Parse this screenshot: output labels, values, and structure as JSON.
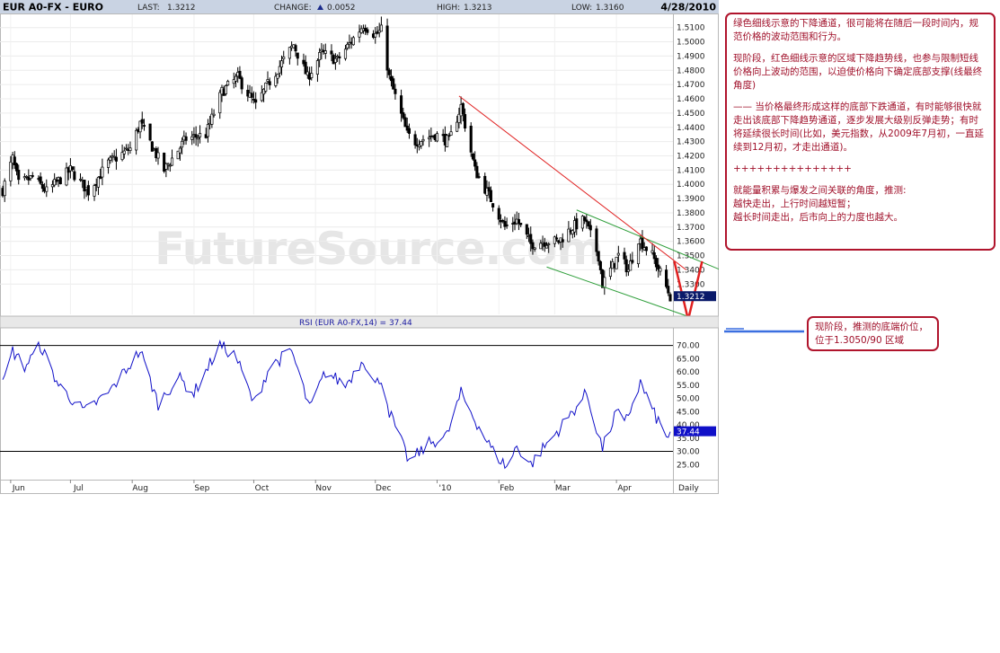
{
  "header": {
    "symbol": "EUR A0-FX - EURO",
    "last_label": "LAST:",
    "last_value": "1.3212",
    "change_label": "CHANGE:",
    "change_value": "0.0052",
    "high_label": "HIGH:",
    "high_value": "1.3213",
    "low_label": "LOW:",
    "low_value": "1.3160",
    "date": "4/28/2010"
  },
  "watermark": "FutureSource.com",
  "rsi_header": "RSI (EUR A0-FX,14) = 37.44",
  "timeframe": "Daily",
  "notes": {
    "main": [
      "绿色细线示意的下降通道，很可能将在随后一段时间内，规范价格的波动范围和行为。",
      "现阶段，红色细线示意的区域下降趋势线，也参与限制短线价格向上波动的范围，以迫使价格向下确定底部支撑(线最终角度)",
      "—— 当价格最终形成这样的底部下跌通道，有时能够很快就走出该底部下降趋势通道，逐步发展大级别反弹走势；有时将延续很长时间(比如，美元指数，从2009年7月初，一直延续到12月初，才走出通道)。",
      "+++++++++++++++",
      "就能量积累与爆发之间关联的角度，推测:\n越快走出，上行时间越短暂；\n越长时间走出，后市向上的力度也越大。"
    ],
    "side": "现阶段，推测的底端价位，位于1.3050/90 区域"
  },
  "chart_data": [
    {
      "type": "candlestick",
      "title": "EUR A0-FX - EURO",
      "x_tick_labels": [
        "Jun",
        "Jul",
        "Aug",
        "Sep",
        "Oct",
        "Nov",
        "Dec",
        "'10",
        "Feb",
        "Mar",
        "Apr"
      ],
      "y_tick_labels": [
        "1.5100",
        "1.5000",
        "1.4900",
        "1.4800",
        "1.4700",
        "1.4600",
        "1.4500",
        "1.4400",
        "1.4300",
        "1.4200",
        "1.4100",
        "1.4000",
        "1.3900",
        "1.3800",
        "1.3700",
        "1.3600",
        "1.3500",
        "1.3400",
        "1.3300"
      ],
      "ylim": [
        1.31,
        1.518
      ],
      "last_price_label": "1.3212",
      "grid": true,
      "close_waypoints": [
        {
          "x": "2009-05-28",
          "y": 1.396
        },
        {
          "x": "2009-06-02",
          "y": 1.418
        },
        {
          "x": "2009-06-05",
          "y": 1.4
        },
        {
          "x": "2009-06-12",
          "y": 1.405
        },
        {
          "x": "2009-06-19",
          "y": 1.395
        },
        {
          "x": "2009-07-01",
          "y": 1.41
        },
        {
          "x": "2009-07-10",
          "y": 1.395
        },
        {
          "x": "2009-07-20",
          "y": 1.415
        },
        {
          "x": "2009-07-31",
          "y": 1.425
        },
        {
          "x": "2009-08-05",
          "y": 1.443
        },
        {
          "x": "2009-08-17",
          "y": 1.41
        },
        {
          "x": "2009-08-28",
          "y": 1.432
        },
        {
          "x": "2009-09-07",
          "y": 1.435
        },
        {
          "x": "2009-09-15",
          "y": 1.465
        },
        {
          "x": "2009-09-23",
          "y": 1.475
        },
        {
          "x": "2009-10-02",
          "y": 1.455
        },
        {
          "x": "2009-10-08",
          "y": 1.47
        },
        {
          "x": "2009-10-21",
          "y": 1.498
        },
        {
          "x": "2009-10-28",
          "y": 1.475
        },
        {
          "x": "2009-11-04",
          "y": 1.492
        },
        {
          "x": "2009-11-12",
          "y": 1.487
        },
        {
          "x": "2009-11-25",
          "y": 1.512
        },
        {
          "x": "2009-12-01",
          "y": 1.505
        },
        {
          "x": "2009-12-04",
          "y": 1.508
        },
        {
          "x": "2009-12-08",
          "y": 1.475
        },
        {
          "x": "2009-12-17",
          "y": 1.435
        },
        {
          "x": "2009-12-21",
          "y": 1.43
        },
        {
          "x": "2009-12-31",
          "y": 1.435
        },
        {
          "x": "2010-01-07",
          "y": 1.43
        },
        {
          "x": "2010-01-13",
          "y": 1.455
        },
        {
          "x": "2010-01-20",
          "y": 1.41
        },
        {
          "x": "2010-01-29",
          "y": 1.387
        },
        {
          "x": "2010-02-04",
          "y": 1.37
        },
        {
          "x": "2010-02-10",
          "y": 1.375
        },
        {
          "x": "2010-02-17",
          "y": 1.358
        },
        {
          "x": "2010-02-23",
          "y": 1.36
        },
        {
          "x": "2010-03-03",
          "y": 1.36
        },
        {
          "x": "2010-03-10",
          "y": 1.37
        },
        {
          "x": "2010-03-16",
          "y": 1.375
        },
        {
          "x": "2010-03-23",
          "y": 1.35
        },
        {
          "x": "2010-03-25",
          "y": 1.33
        },
        {
          "x": "2010-04-02",
          "y": 1.35
        },
        {
          "x": "2010-04-07",
          "y": 1.34
        },
        {
          "x": "2010-04-12",
          "y": 1.362
        },
        {
          "x": "2010-04-19",
          "y": 1.35
        },
        {
          "x": "2010-04-23",
          "y": 1.338
        },
        {
          "x": "2010-04-28",
          "y": 1.3212
        }
      ],
      "annotations": {
        "green_channel_upper": [
          {
            "x": "2010-03-12",
            "y": 1.382
          },
          {
            "x": "2010-06-18",
            "y": 1.325
          }
        ],
        "green_channel_lower": [
          {
            "x": "2010-02-25",
            "y": 1.342
          },
          {
            "x": "2010-05-30",
            "y": 1.296
          }
        ],
        "red_trendline": [
          {
            "x": "2010-01-12",
            "y": 1.462
          },
          {
            "x": "2010-05-06",
            "y": 1.34
          }
        ],
        "red_v_projection": [
          {
            "x": "2010-04-30",
            "y": 1.346
          },
          {
            "x": "2010-05-07",
            "y": 1.305
          },
          {
            "x": "2010-05-14",
            "y": 1.346
          }
        ]
      }
    },
    {
      "type": "line",
      "title": "RSI (EUR A0-FX,14) = 37.44",
      "y_tick_labels": [
        "70.00",
        "65.00",
        "60.00",
        "55.00",
        "50.00",
        "45.00",
        "40.00",
        "35.00",
        "30.00",
        "25.00"
      ],
      "ylim": [
        20,
        76
      ],
      "reference_lines": [
        70,
        30
      ],
      "last_value": 37.44,
      "last_value_label": "37.44",
      "waypoints": [
        {
          "x": "2009-05-28",
          "y": 55
        },
        {
          "x": "2009-06-02",
          "y": 68
        },
        {
          "x": "2009-06-08",
          "y": 62
        },
        {
          "x": "2009-06-16",
          "y": 70
        },
        {
          "x": "2009-06-25",
          "y": 55
        },
        {
          "x": "2009-07-08",
          "y": 45
        },
        {
          "x": "2009-07-20",
          "y": 52
        },
        {
          "x": "2009-08-05",
          "y": 68
        },
        {
          "x": "2009-08-14",
          "y": 48
        },
        {
          "x": "2009-08-24",
          "y": 58
        },
        {
          "x": "2009-09-01",
          "y": 52
        },
        {
          "x": "2009-09-14",
          "y": 70
        },
        {
          "x": "2009-09-22",
          "y": 66
        },
        {
          "x": "2009-10-01",
          "y": 48
        },
        {
          "x": "2009-10-09",
          "y": 62
        },
        {
          "x": "2009-10-20",
          "y": 68
        },
        {
          "x": "2009-10-29",
          "y": 46
        },
        {
          "x": "2009-11-06",
          "y": 60
        },
        {
          "x": "2009-11-16",
          "y": 55
        },
        {
          "x": "2009-11-25",
          "y": 65
        },
        {
          "x": "2009-12-01",
          "y": 55
        },
        {
          "x": "2009-12-04",
          "y": 58
        },
        {
          "x": "2009-12-08",
          "y": 45
        },
        {
          "x": "2009-12-18",
          "y": 26
        },
        {
          "x": "2009-12-28",
          "y": 33
        },
        {
          "x": "2010-01-06",
          "y": 36
        },
        {
          "x": "2010-01-13",
          "y": 52
        },
        {
          "x": "2010-01-20",
          "y": 42
        },
        {
          "x": "2010-01-29",
          "y": 30
        },
        {
          "x": "2010-02-05",
          "y": 24
        },
        {
          "x": "2010-02-10",
          "y": 32
        },
        {
          "x": "2010-02-17",
          "y": 25
        },
        {
          "x": "2010-02-23",
          "y": 31
        },
        {
          "x": "2010-03-05",
          "y": 40
        },
        {
          "x": "2010-03-17",
          "y": 52
        },
        {
          "x": "2010-03-25",
          "y": 31
        },
        {
          "x": "2010-04-01",
          "y": 45
        },
        {
          "x": "2010-04-05",
          "y": 40
        },
        {
          "x": "2010-04-13",
          "y": 56
        },
        {
          "x": "2010-04-20",
          "y": 44
        },
        {
          "x": "2010-04-23",
          "y": 40
        },
        {
          "x": "2010-04-26",
          "y": 35
        },
        {
          "x": "2010-04-28",
          "y": 37.44
        }
      ]
    }
  ],
  "colors": {
    "price_bars": "#000000",
    "rsi_line": "#1010c8",
    "green_channel": "#2e9e3a",
    "red_annotation": "#e02020",
    "header_bg": "#c8d2e2",
    "label_box": "#0a1a6a",
    "blue_arrow": "#3b6fe0",
    "note_border": "#b0142c"
  }
}
